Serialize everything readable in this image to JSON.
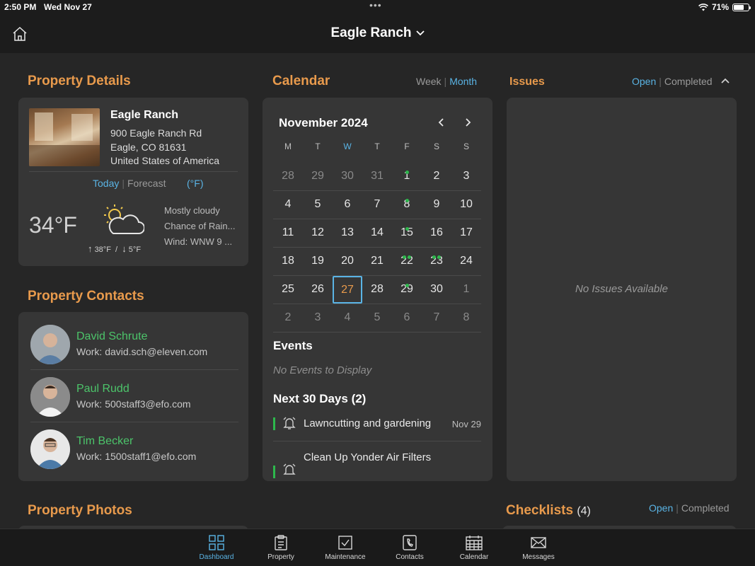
{
  "status": {
    "time": "2:50 PM",
    "date": "Wed Nov 27",
    "battery": "71%",
    "battery_level": 0.71
  },
  "header": {
    "title": "Eagle Ranch"
  },
  "property": {
    "section_title": "Property Details",
    "name": "Eagle Ranch",
    "address1": "900 Eagle Ranch Rd",
    "address2": "Eagle, CO 81631",
    "country": "United States of America",
    "weather_tabs": {
      "today": "Today",
      "forecast": "Forecast",
      "unit": "(°F)"
    },
    "temp": "34°F",
    "high": "38°F",
    "low": "5°F",
    "high_low_sep": "/",
    "conditions": [
      "Mostly cloudy",
      "Chance of Rain...",
      "Wind: WNW 9 ..."
    ]
  },
  "contacts": {
    "section_title": "Property Contacts",
    "items": [
      {
        "name": "David Schrute",
        "email": "Work: david.sch@eleven.com"
      },
      {
        "name": "Paul Rudd",
        "email": "Work: 500staff3@efo.com"
      },
      {
        "name": "Tim Becker",
        "email": "Work: 1500staff1@efo.com"
      }
    ]
  },
  "calendar": {
    "section_title": "Calendar",
    "view_week": "Week",
    "view_month": "Month",
    "month_label": "November 2024",
    "dow": [
      "M",
      "T",
      "W",
      "T",
      "F",
      "S",
      "S"
    ],
    "weeks": [
      [
        {
          "d": "28",
          "dim": true
        },
        {
          "d": "29",
          "dim": true
        },
        {
          "d": "30",
          "dim": true
        },
        {
          "d": "31",
          "dim": true
        },
        {
          "d": "1",
          "dots": 1
        },
        {
          "d": "2"
        },
        {
          "d": "3"
        }
      ],
      [
        {
          "d": "4"
        },
        {
          "d": "5"
        },
        {
          "d": "6"
        },
        {
          "d": "7"
        },
        {
          "d": "8",
          "dots": 1
        },
        {
          "d": "9"
        },
        {
          "d": "10"
        }
      ],
      [
        {
          "d": "11"
        },
        {
          "d": "12"
        },
        {
          "d": "13"
        },
        {
          "d": "14"
        },
        {
          "d": "15",
          "dots": 1
        },
        {
          "d": "16"
        },
        {
          "d": "17"
        }
      ],
      [
        {
          "d": "18"
        },
        {
          "d": "19"
        },
        {
          "d": "20"
        },
        {
          "d": "21"
        },
        {
          "d": "22",
          "dots": 2
        },
        {
          "d": "23",
          "dots": 2
        },
        {
          "d": "24"
        }
      ],
      [
        {
          "d": "25"
        },
        {
          "d": "26"
        },
        {
          "d": "27",
          "today": true
        },
        {
          "d": "28"
        },
        {
          "d": "29",
          "dots": 1
        },
        {
          "d": "30"
        },
        {
          "d": "1",
          "dim": true
        }
      ],
      [
        {
          "d": "2",
          "dim": true
        },
        {
          "d": "3",
          "dim": true
        },
        {
          "d": "4",
          "dim": true
        },
        {
          "d": "5",
          "dim": true
        },
        {
          "d": "6",
          "dim": true
        },
        {
          "d": "7",
          "dim": true
        },
        {
          "d": "8",
          "dim": true
        }
      ]
    ],
    "events_title": "Events",
    "no_events": "No Events to Display",
    "next_title": "Next 30 Days (2)",
    "upcoming": [
      {
        "title": "Lawncutting and gardening",
        "date": "Nov 29"
      },
      {
        "title": "Clean Up Yonder Air Filters",
        "date": ""
      }
    ]
  },
  "issues": {
    "section_title": "Issues",
    "tab_open": "Open",
    "tab_completed": "Completed",
    "empty": "No Issues Available"
  },
  "photos": {
    "section_title": "Property Photos"
  },
  "checklists": {
    "section_title": "Checklists",
    "count": "(4)",
    "tab_open": "Open",
    "tab_completed": "Completed"
  },
  "tabs": [
    {
      "label": "Dashboard",
      "icon": "dashboard-icon",
      "active": true
    },
    {
      "label": "Property",
      "icon": "clipboard-icon"
    },
    {
      "label": "Maintenance",
      "icon": "checkbox-icon"
    },
    {
      "label": "Contacts",
      "icon": "phone-icon"
    },
    {
      "label": "Calendar",
      "icon": "calendar-icon"
    },
    {
      "label": "Messages",
      "icon": "envelope-icon"
    }
  ],
  "colors": {
    "accent_orange": "#e89a4c",
    "accent_blue": "#5ab4e5",
    "accent_green": "#4cc46a"
  }
}
